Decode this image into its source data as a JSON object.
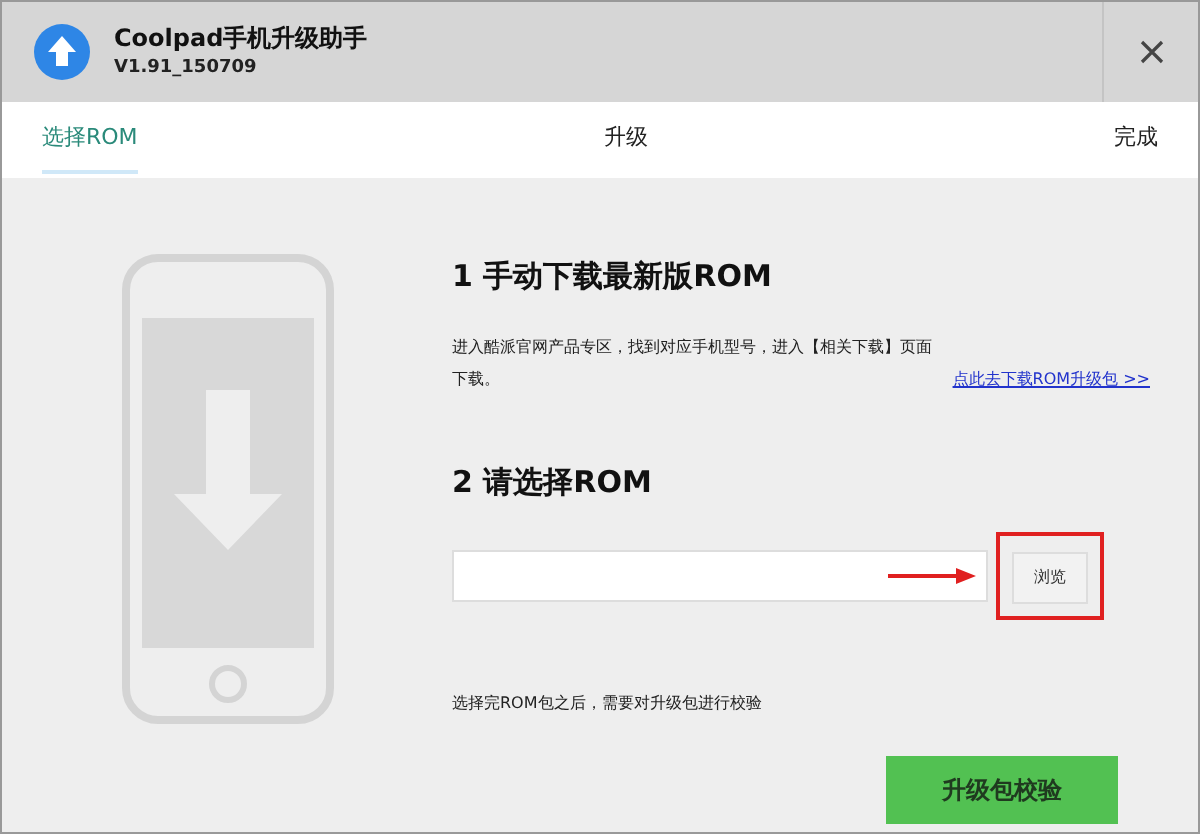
{
  "window": {
    "title": "Coolpad手机升级助手",
    "version": "V1.91_150709"
  },
  "steps": [
    {
      "label": "选择ROM",
      "selected": true
    },
    {
      "label": "升级",
      "selected": false
    },
    {
      "label": "完成",
      "selected": false
    }
  ],
  "section1": {
    "heading": "1 手动下载最新版ROM",
    "description": "进入酷派官网产品专区，找到对应手机型号，进入【相关下载】页面下载。",
    "link": "点此去下载ROM升级包 >>"
  },
  "section2": {
    "heading": "2 请选择ROM",
    "browse_button": "浏览",
    "highlighted": true,
    "hint": "选择完ROM包之后，需要对升级包进行校验"
  },
  "primary_button": "升级包校验"
}
